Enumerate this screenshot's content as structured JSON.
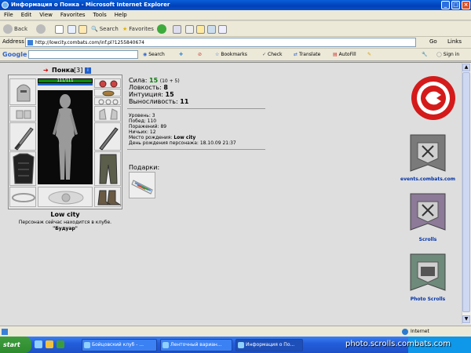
{
  "window": {
    "title": "Информация о Понка - Microsoft Internet Explorer"
  },
  "menu": [
    "File",
    "Edit",
    "View",
    "Favorites",
    "Tools",
    "Help"
  ],
  "toolbar": {
    "back": "Back",
    "search": "Search",
    "favorites": "Favorites"
  },
  "address": {
    "label": "Address",
    "url": "http://lowcity.combats.com/inf.pl?1255840674",
    "go": "Go",
    "links": "Links"
  },
  "google": {
    "logo": "Google",
    "search": "Search",
    "bookmarks": "Bookmarks",
    "check": "Check",
    "translate": "Translate",
    "autofill": "AutoFill",
    "signin": "Sign in"
  },
  "character": {
    "name": "Понка",
    "level": "[3]",
    "hp": "111/111",
    "city": "Low city",
    "location_text": "Персонаж сейчас находится в клубе.",
    "location_place": "\"Будуар\""
  },
  "stats": [
    {
      "label": "Сила:",
      "value": "15",
      "extra": "(10 + 5)"
    },
    {
      "label": "Ловкость:",
      "value": "8",
      "extra": ""
    },
    {
      "label": "Интуиция:",
      "value": "15",
      "extra": ""
    },
    {
      "label": "Выносливость:",
      "value": "11",
      "extra": ""
    }
  ],
  "info": [
    {
      "label": "Уровень:",
      "value": "3"
    },
    {
      "label": "Побед:",
      "value": "110"
    },
    {
      "label": "Поражений:",
      "value": "89"
    },
    {
      "label": "Ничьих:",
      "value": "12"
    },
    {
      "label": "Место рождения:",
      "value": "Low city"
    },
    {
      "label": "День рождения персонажа:",
      "value": "18.10.09 21:37"
    }
  ],
  "gifts": {
    "label": "Подарки:"
  },
  "banners": [
    {
      "label": "events.combats.com"
    },
    {
      "label": "Scrolls"
    },
    {
      "label": "Photo Scrolls"
    }
  ],
  "status": {
    "zone": "Internet"
  },
  "taskbar": {
    "start": "start",
    "tasks": [
      "Бойцовский клуб - ...",
      "Ленточный вариан...",
      "Информация о По..."
    ],
    "watermark": "photo.scrolls.combats.com"
  },
  "colors": {
    "hp": "#0a8a0a",
    "logo_red": "#d41a1a",
    "link_blue": "#0033aa",
    "xp_blue": "#1f5fd0"
  }
}
